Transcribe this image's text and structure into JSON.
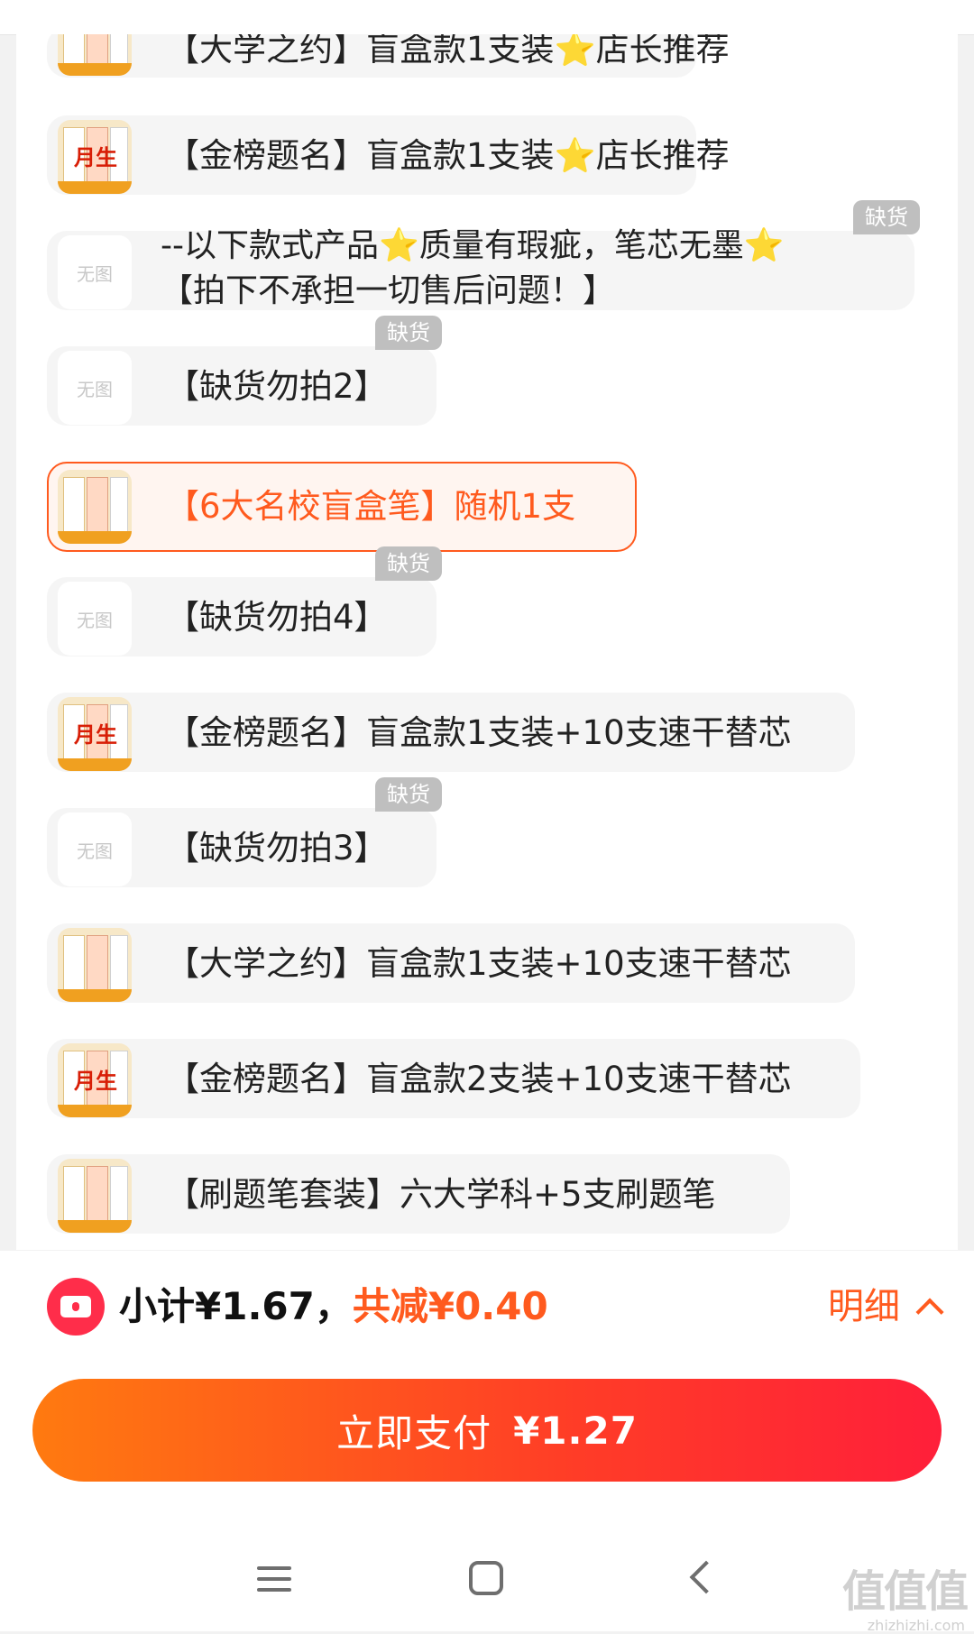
{
  "skus": [
    {
      "label_parts": [
        "【大学之约】盲盒款1支装",
        "⭐",
        "店长推荐"
      ],
      "image": "pen-photo",
      "sold_out": false,
      "selected": false
    },
    {
      "label_parts": [
        "【金榜题名】盲盒款1支装",
        "⭐",
        "店长推荐"
      ],
      "image": "pen-photo",
      "sold_out": false,
      "selected": false
    },
    {
      "label_parts": [
        "--以下款式产品",
        "⭐",
        "质量有瑕疵，笔芯无墨",
        "⭐"
      ],
      "label_line2": "【拍下不承担一切售后问题！】",
      "image": "no-image",
      "sold_out": true,
      "selected": false
    },
    {
      "label_parts": [
        "【缺货勿拍2】"
      ],
      "image": "no-image",
      "sold_out": true,
      "selected": false
    },
    {
      "label_parts": [
        "【6大名校盲盒笔】随机1支"
      ],
      "image": "pen-photo",
      "sold_out": false,
      "selected": true
    },
    {
      "label_parts": [
        "【缺货勿拍4】"
      ],
      "image": "no-image",
      "sold_out": true,
      "selected": false
    },
    {
      "label_parts": [
        "【金榜题名】盲盒款1支装+10支速干替芯"
      ],
      "image": "pen-photo",
      "sold_out": false,
      "selected": false
    },
    {
      "label_parts": [
        "【缺货勿拍3】"
      ],
      "image": "no-image",
      "sold_out": true,
      "selected": false
    },
    {
      "label_parts": [
        "【大学之约】盲盒款1支装+10支速干替芯"
      ],
      "image": "pen-photo",
      "sold_out": false,
      "selected": false
    },
    {
      "label_parts": [
        "【金榜题名】盲盒款2支装+10支速干替芯"
      ],
      "image": "pen-photo",
      "sold_out": false,
      "selected": false
    },
    {
      "label_parts": [
        "【刷题笔套装】六大学科+5支刷题笔"
      ],
      "image": "pen-photo",
      "sold_out": false,
      "selected": false
    }
  ],
  "no_image_text": "无图",
  "sold_out_badge": "缺货",
  "thumb_text": "月生",
  "footer": {
    "subtotal_text": "小计¥1.67，",
    "discount_text": "共减¥0.40",
    "detail_label": "明细",
    "pay_label": "立即支付",
    "pay_amount": "¥1.27"
  },
  "watermark": {
    "text": "值值值",
    "url": "zhizhizhi.com"
  },
  "colors": {
    "accent": "#ff5a1e",
    "badge_gray": "#bfbfbf",
    "coupon_red": "#ff2d4a",
    "star": "#f7b500"
  }
}
